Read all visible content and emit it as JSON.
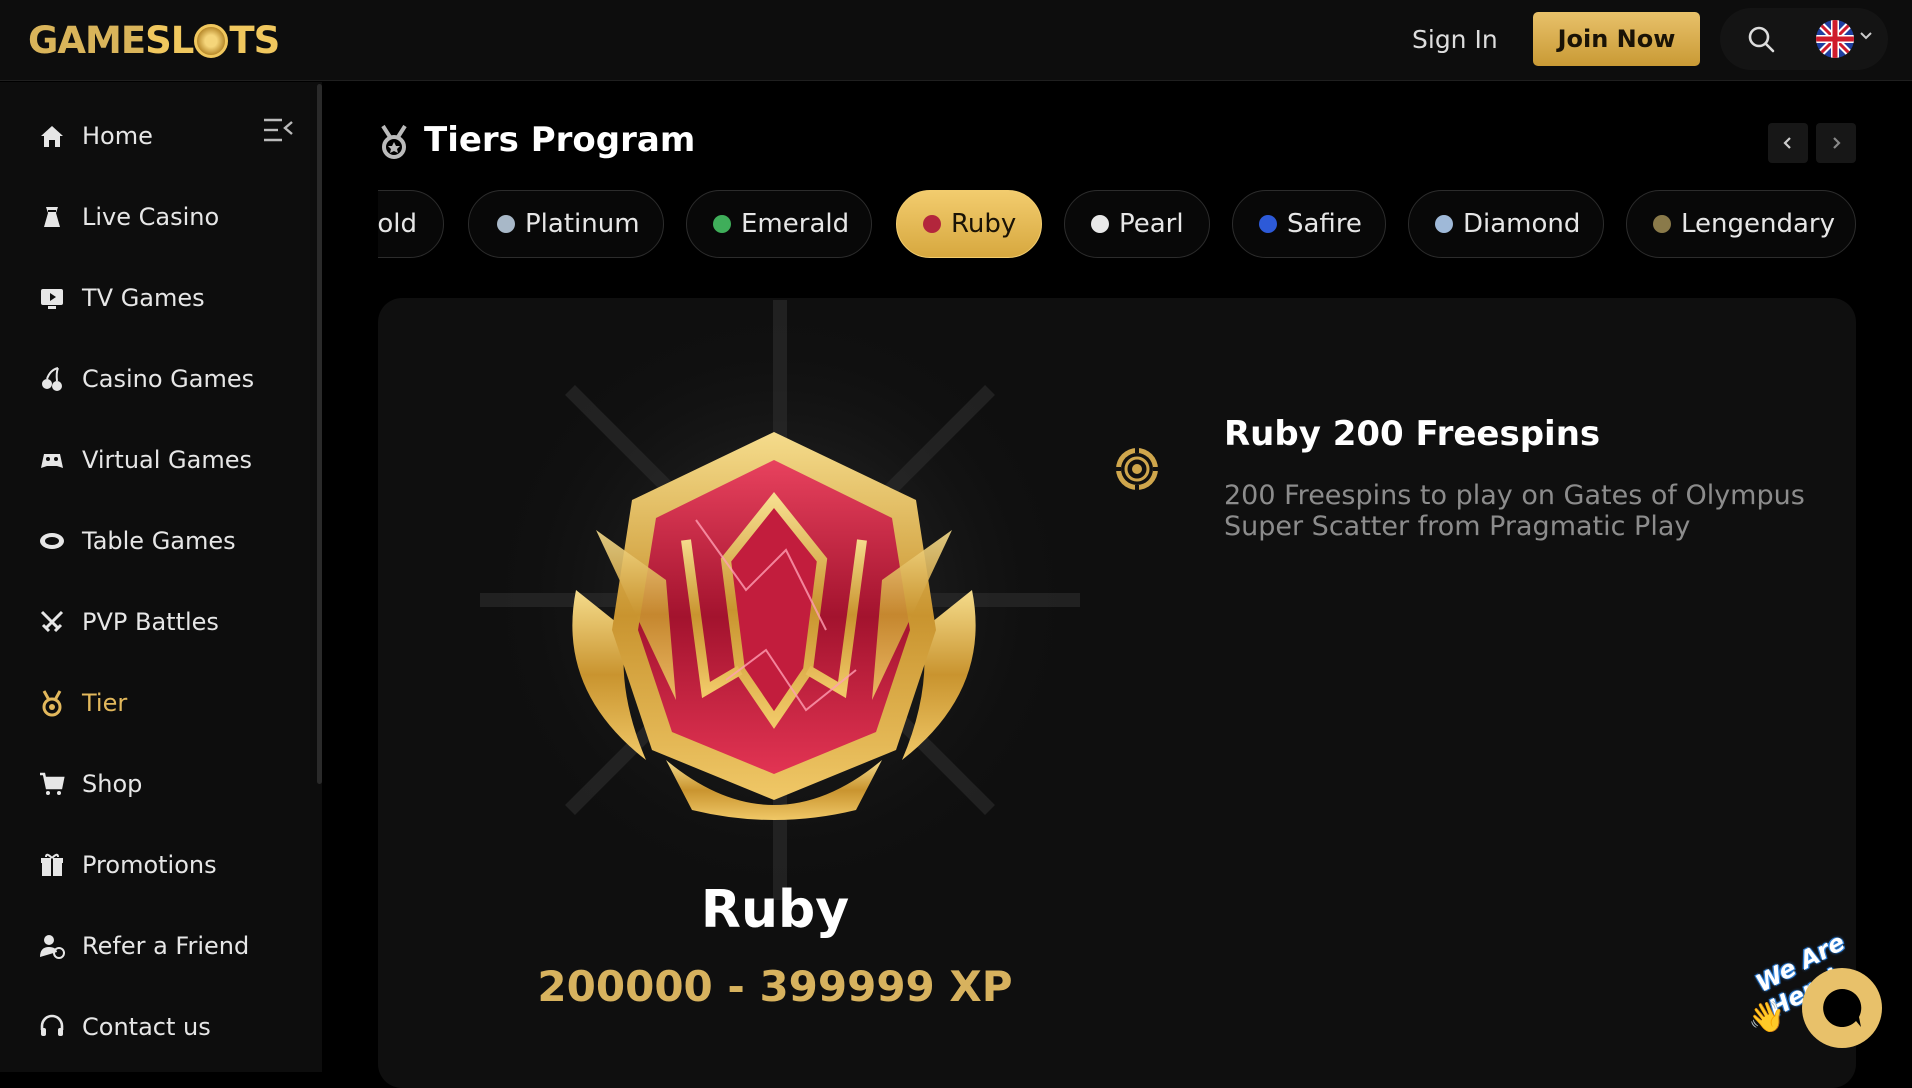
{
  "header": {
    "logo_game": "GAME",
    "logo_sl": "SL",
    "logo_ts": "TS",
    "signin_label": "Sign In",
    "join_label": "Join Now",
    "language": "English"
  },
  "sidebar": {
    "items": [
      {
        "label": "Home",
        "icon": "home-icon",
        "active": false
      },
      {
        "label": "Live Casino",
        "icon": "live-casino-icon",
        "active": false
      },
      {
        "label": "TV Games",
        "icon": "tv-icon",
        "active": false
      },
      {
        "label": "Casino Games",
        "icon": "cherries-icon",
        "active": false
      },
      {
        "label": "Virtual Games",
        "icon": "virtual-games-icon",
        "active": false
      },
      {
        "label": "Table Games",
        "icon": "table-games-icon",
        "active": false
      },
      {
        "label": "PVP Battles",
        "icon": "swords-icon",
        "active": false
      },
      {
        "label": "Tier",
        "icon": "medal-icon",
        "active": true
      },
      {
        "label": "Shop",
        "icon": "cart-icon",
        "active": false
      },
      {
        "label": "Promotions",
        "icon": "gift-icon",
        "active": false
      },
      {
        "label": "Refer a Friend",
        "icon": "refer-icon",
        "active": false
      },
      {
        "label": "Contact us",
        "icon": "headset-icon",
        "active": false
      }
    ]
  },
  "main": {
    "title": "Tiers Program",
    "tabs": [
      {
        "label": "Gold",
        "gem_color": "#d4a93c",
        "active": false
      },
      {
        "label": "Platinum",
        "gem_color": "#a8b8c8",
        "active": false
      },
      {
        "label": "Emerald",
        "gem_color": "#3fae5a",
        "active": false
      },
      {
        "label": "Ruby",
        "gem_color": "#b3263c",
        "active": true
      },
      {
        "label": "Pearl",
        "gem_color": "#e8e8e8",
        "active": false
      },
      {
        "label": "Safire",
        "gem_color": "#2d5ad8",
        "active": false
      },
      {
        "label": "Diamond",
        "gem_color": "#9fb9d8",
        "active": false
      },
      {
        "label": "Lengendary",
        "gem_color": "#8a7a4a",
        "active": false
      }
    ],
    "tier": {
      "name": "Ruby",
      "xp_range": "200000 - 399999 XP"
    },
    "reward": {
      "title": "Ruby 200 Freespins",
      "description": "200 Freespins to play on Gates of Olympus Super Scatter from Pragmatic Play"
    }
  },
  "chat": {
    "label": "We Are Here!"
  },
  "colors": {
    "accent": "#e2b85c",
    "background": "#000000",
    "panel": "#0f0f0f"
  }
}
